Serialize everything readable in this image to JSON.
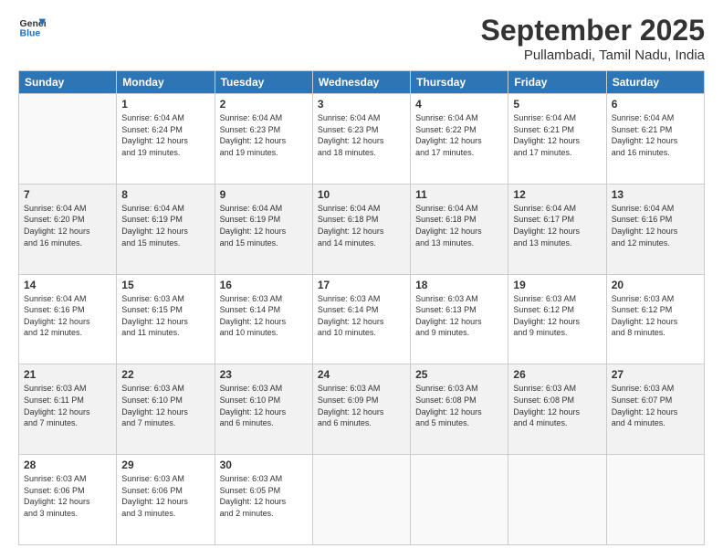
{
  "logo": {
    "line1": "General",
    "line2": "Blue"
  },
  "title": "September 2025",
  "location": "Pullambadi, Tamil Nadu, India",
  "weekdays": [
    "Sunday",
    "Monday",
    "Tuesday",
    "Wednesday",
    "Thursday",
    "Friday",
    "Saturday"
  ],
  "weeks": [
    [
      {
        "day": "",
        "info": ""
      },
      {
        "day": "1",
        "info": "Sunrise: 6:04 AM\nSunset: 6:24 PM\nDaylight: 12 hours\nand 19 minutes."
      },
      {
        "day": "2",
        "info": "Sunrise: 6:04 AM\nSunset: 6:23 PM\nDaylight: 12 hours\nand 19 minutes."
      },
      {
        "day": "3",
        "info": "Sunrise: 6:04 AM\nSunset: 6:23 PM\nDaylight: 12 hours\nand 18 minutes."
      },
      {
        "day": "4",
        "info": "Sunrise: 6:04 AM\nSunset: 6:22 PM\nDaylight: 12 hours\nand 17 minutes."
      },
      {
        "day": "5",
        "info": "Sunrise: 6:04 AM\nSunset: 6:21 PM\nDaylight: 12 hours\nand 17 minutes."
      },
      {
        "day": "6",
        "info": "Sunrise: 6:04 AM\nSunset: 6:21 PM\nDaylight: 12 hours\nand 16 minutes."
      }
    ],
    [
      {
        "day": "7",
        "info": "Sunrise: 6:04 AM\nSunset: 6:20 PM\nDaylight: 12 hours\nand 16 minutes."
      },
      {
        "day": "8",
        "info": "Sunrise: 6:04 AM\nSunset: 6:19 PM\nDaylight: 12 hours\nand 15 minutes."
      },
      {
        "day": "9",
        "info": "Sunrise: 6:04 AM\nSunset: 6:19 PM\nDaylight: 12 hours\nand 15 minutes."
      },
      {
        "day": "10",
        "info": "Sunrise: 6:04 AM\nSunset: 6:18 PM\nDaylight: 12 hours\nand 14 minutes."
      },
      {
        "day": "11",
        "info": "Sunrise: 6:04 AM\nSunset: 6:18 PM\nDaylight: 12 hours\nand 13 minutes."
      },
      {
        "day": "12",
        "info": "Sunrise: 6:04 AM\nSunset: 6:17 PM\nDaylight: 12 hours\nand 13 minutes."
      },
      {
        "day": "13",
        "info": "Sunrise: 6:04 AM\nSunset: 6:16 PM\nDaylight: 12 hours\nand 12 minutes."
      }
    ],
    [
      {
        "day": "14",
        "info": "Sunrise: 6:04 AM\nSunset: 6:16 PM\nDaylight: 12 hours\nand 12 minutes."
      },
      {
        "day": "15",
        "info": "Sunrise: 6:03 AM\nSunset: 6:15 PM\nDaylight: 12 hours\nand 11 minutes."
      },
      {
        "day": "16",
        "info": "Sunrise: 6:03 AM\nSunset: 6:14 PM\nDaylight: 12 hours\nand 10 minutes."
      },
      {
        "day": "17",
        "info": "Sunrise: 6:03 AM\nSunset: 6:14 PM\nDaylight: 12 hours\nand 10 minutes."
      },
      {
        "day": "18",
        "info": "Sunrise: 6:03 AM\nSunset: 6:13 PM\nDaylight: 12 hours\nand 9 minutes."
      },
      {
        "day": "19",
        "info": "Sunrise: 6:03 AM\nSunset: 6:12 PM\nDaylight: 12 hours\nand 9 minutes."
      },
      {
        "day": "20",
        "info": "Sunrise: 6:03 AM\nSunset: 6:12 PM\nDaylight: 12 hours\nand 8 minutes."
      }
    ],
    [
      {
        "day": "21",
        "info": "Sunrise: 6:03 AM\nSunset: 6:11 PM\nDaylight: 12 hours\nand 7 minutes."
      },
      {
        "day": "22",
        "info": "Sunrise: 6:03 AM\nSunset: 6:10 PM\nDaylight: 12 hours\nand 7 minutes."
      },
      {
        "day": "23",
        "info": "Sunrise: 6:03 AM\nSunset: 6:10 PM\nDaylight: 12 hours\nand 6 minutes."
      },
      {
        "day": "24",
        "info": "Sunrise: 6:03 AM\nSunset: 6:09 PM\nDaylight: 12 hours\nand 6 minutes."
      },
      {
        "day": "25",
        "info": "Sunrise: 6:03 AM\nSunset: 6:08 PM\nDaylight: 12 hours\nand 5 minutes."
      },
      {
        "day": "26",
        "info": "Sunrise: 6:03 AM\nSunset: 6:08 PM\nDaylight: 12 hours\nand 4 minutes."
      },
      {
        "day": "27",
        "info": "Sunrise: 6:03 AM\nSunset: 6:07 PM\nDaylight: 12 hours\nand 4 minutes."
      }
    ],
    [
      {
        "day": "28",
        "info": "Sunrise: 6:03 AM\nSunset: 6:06 PM\nDaylight: 12 hours\nand 3 minutes."
      },
      {
        "day": "29",
        "info": "Sunrise: 6:03 AM\nSunset: 6:06 PM\nDaylight: 12 hours\nand 3 minutes."
      },
      {
        "day": "30",
        "info": "Sunrise: 6:03 AM\nSunset: 6:05 PM\nDaylight: 12 hours\nand 2 minutes."
      },
      {
        "day": "",
        "info": ""
      },
      {
        "day": "",
        "info": ""
      },
      {
        "day": "",
        "info": ""
      },
      {
        "day": "",
        "info": ""
      }
    ]
  ]
}
